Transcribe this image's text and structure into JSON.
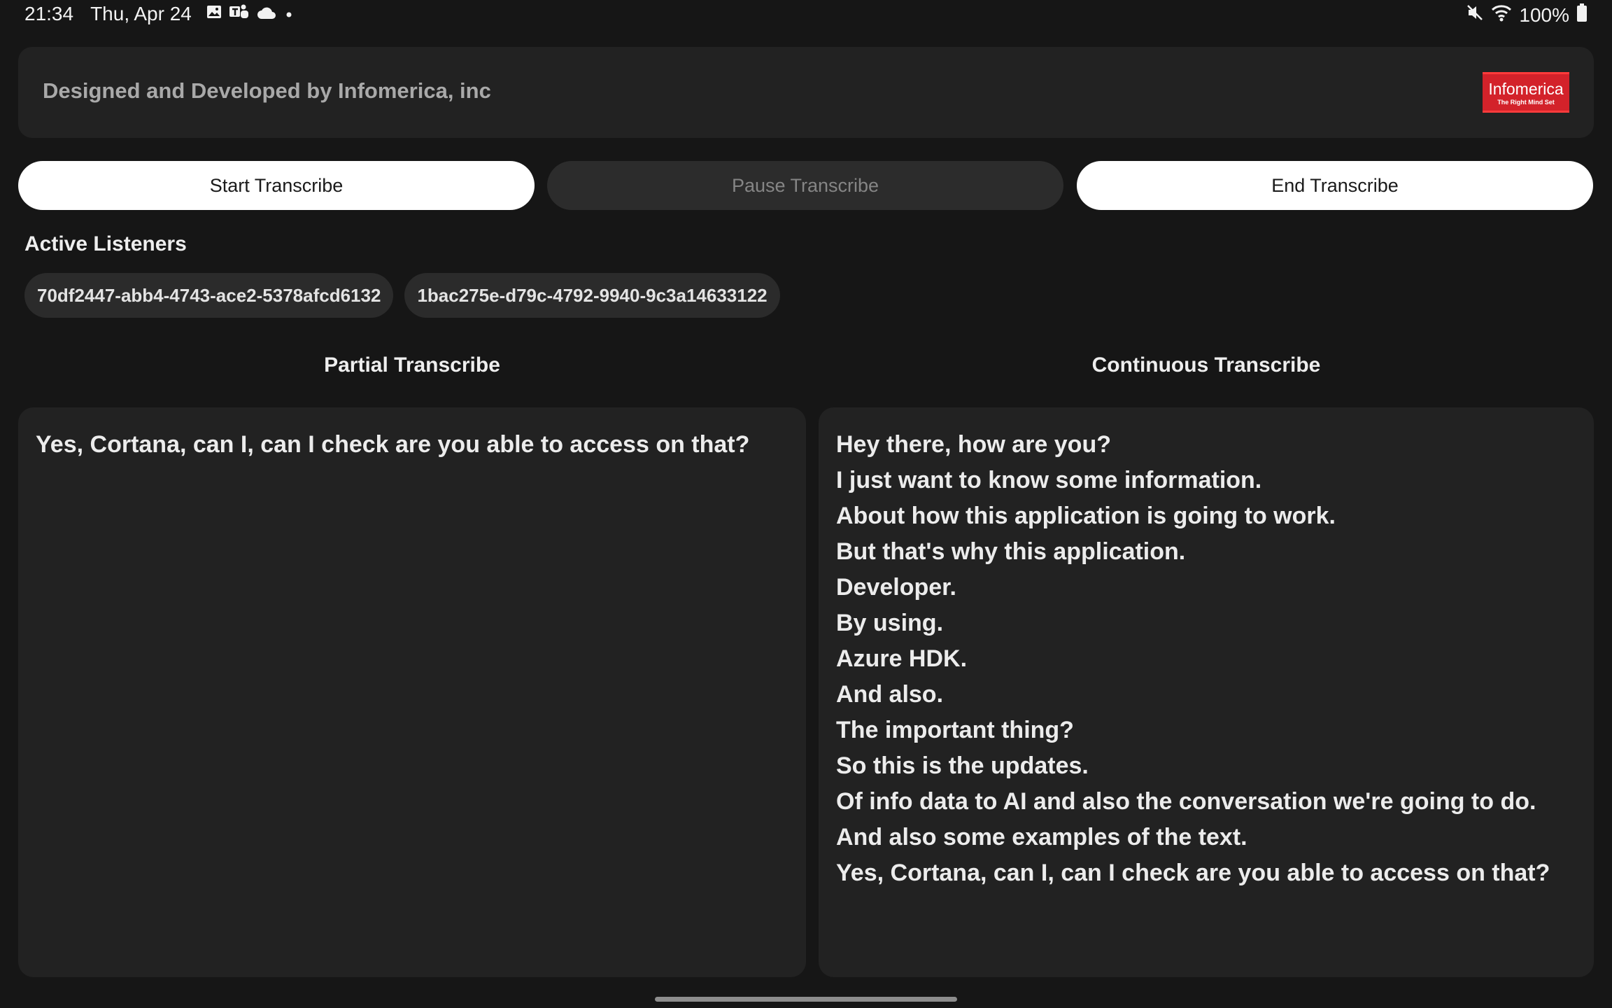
{
  "status_bar": {
    "time": "21:34",
    "date": "Thu, Apr 24",
    "notification_icons": [
      "gallery-icon",
      "teams-icon",
      "cloud-icon",
      "dot-icon"
    ],
    "mute_icon": "mute-icon",
    "wifi_icon": "wifi-icon",
    "battery_percent": "100%"
  },
  "header": {
    "text": "Designed and Developed by Infomerica, inc",
    "logo_title": "Infomerica",
    "logo_tagline": "The Right Mind Set",
    "logo_color": "#d3222a"
  },
  "buttons": {
    "start": "Start Transcribe",
    "pause": "Pause Transcribe",
    "end": "End Transcribe"
  },
  "listeners": {
    "title": "Active Listeners",
    "items": [
      "70df2447-abb4-4743-ace2-5378afcd6132",
      "1bac275e-d79c-4792-9940-9c3a14633122"
    ]
  },
  "partial": {
    "title": "Partial Transcribe",
    "text": "Yes, Cortana, can I, can I check are you able to access on that?"
  },
  "continuous": {
    "title": "Continuous Transcribe",
    "lines": [
      "Hey there, how are you?",
      "I just want to know some information.",
      "About how this application is going to work.",
      "But that's why this application.",
      "Developer.",
      "By using.",
      "Azure HDK.",
      "And also.",
      "The important thing?",
      "So this is the updates.",
      "Of info data to AI and also the conversation we're going to do.",
      "And also some examples of the text.",
      "Yes, Cortana, can I, can I check are you able to access on that?"
    ]
  }
}
